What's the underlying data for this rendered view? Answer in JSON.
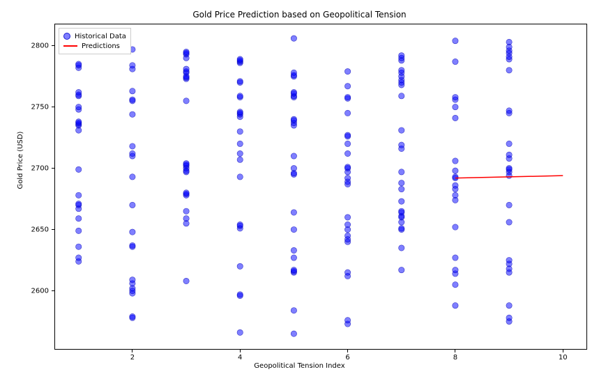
{
  "chart_data": {
    "type": "scatter",
    "title": "Gold Price Prediction based on Geopolitical Tension",
    "xlabel": "Geopolitical Tension Index",
    "ylabel": "Gold Price (USD)",
    "xlim": [
      0.55,
      10.45
    ],
    "ylim": [
      2552,
      2818
    ],
    "xticks": [
      2,
      4,
      6,
      8,
      10
    ],
    "yticks": [
      2600,
      2650,
      2700,
      2750,
      2800
    ],
    "legend": {
      "scatter_label": "Historical Data",
      "line_label": "Predictions"
    },
    "series": [
      {
        "name": "Historical Data",
        "type": "scatter",
        "color": "rgba(0,0,255,0.5)",
        "points": [
          [
            1,
            2624
          ],
          [
            1,
            2627
          ],
          [
            1,
            2636
          ],
          [
            1,
            2649
          ],
          [
            1,
            2659
          ],
          [
            1,
            2667
          ],
          [
            1,
            2670
          ],
          [
            1,
            2671
          ],
          [
            1,
            2678
          ],
          [
            1,
            2699
          ],
          [
            1,
            2731
          ],
          [
            1,
            2735
          ],
          [
            1,
            2736
          ],
          [
            1,
            2737
          ],
          [
            1,
            2738
          ],
          [
            1,
            2748
          ],
          [
            1,
            2750
          ],
          [
            1,
            2759
          ],
          [
            1,
            2760
          ],
          [
            1,
            2762
          ],
          [
            1,
            2782
          ],
          [
            1,
            2784
          ],
          [
            1,
            2785
          ],
          [
            2,
            2578
          ],
          [
            2,
            2579
          ],
          [
            2,
            2598
          ],
          [
            2,
            2600
          ],
          [
            2,
            2602
          ],
          [
            2,
            2606
          ],
          [
            2,
            2609
          ],
          [
            2,
            2636
          ],
          [
            2,
            2637
          ],
          [
            2,
            2648
          ],
          [
            2,
            2670
          ],
          [
            2,
            2693
          ],
          [
            2,
            2710
          ],
          [
            2,
            2712
          ],
          [
            2,
            2718
          ],
          [
            2,
            2744
          ],
          [
            2,
            2755
          ],
          [
            2,
            2756
          ],
          [
            2,
            2763
          ],
          [
            2,
            2781
          ],
          [
            2,
            2784
          ],
          [
            2,
            2797
          ],
          [
            3,
            2608
          ],
          [
            3,
            2655
          ],
          [
            3,
            2659
          ],
          [
            3,
            2665
          ],
          [
            3,
            2678
          ],
          [
            3,
            2679
          ],
          [
            3,
            2680
          ],
          [
            3,
            2697
          ],
          [
            3,
            2698
          ],
          [
            3,
            2700
          ],
          [
            3,
            2702
          ],
          [
            3,
            2703
          ],
          [
            3,
            2704
          ],
          [
            3,
            2755
          ],
          [
            3,
            2773
          ],
          [
            3,
            2774
          ],
          [
            3,
            2775
          ],
          [
            3,
            2778
          ],
          [
            3,
            2779
          ],
          [
            3,
            2781
          ],
          [
            3,
            2790
          ],
          [
            3,
            2793
          ],
          [
            3,
            2794
          ],
          [
            3,
            2795
          ],
          [
            4,
            2566
          ],
          [
            4,
            2596
          ],
          [
            4,
            2597
          ],
          [
            4,
            2620
          ],
          [
            4,
            2651
          ],
          [
            4,
            2653
          ],
          [
            4,
            2654
          ],
          [
            4,
            2693
          ],
          [
            4,
            2707
          ],
          [
            4,
            2712
          ],
          [
            4,
            2720
          ],
          [
            4,
            2730
          ],
          [
            4,
            2742
          ],
          [
            4,
            2744
          ],
          [
            4,
            2745
          ],
          [
            4,
            2746
          ],
          [
            4,
            2758
          ],
          [
            4,
            2759
          ],
          [
            4,
            2770
          ],
          [
            4,
            2771
          ],
          [
            4,
            2786
          ],
          [
            4,
            2787
          ],
          [
            4,
            2788
          ],
          [
            4,
            2789
          ],
          [
            5,
            2565
          ],
          [
            5,
            2584
          ],
          [
            5,
            2615
          ],
          [
            5,
            2616
          ],
          [
            5,
            2617
          ],
          [
            5,
            2627
          ],
          [
            5,
            2633
          ],
          [
            5,
            2650
          ],
          [
            5,
            2664
          ],
          [
            5,
            2695
          ],
          [
            5,
            2696
          ],
          [
            5,
            2700
          ],
          [
            5,
            2710
          ],
          [
            5,
            2735
          ],
          [
            5,
            2737
          ],
          [
            5,
            2739
          ],
          [
            5,
            2740
          ],
          [
            5,
            2758
          ],
          [
            5,
            2759
          ],
          [
            5,
            2761
          ],
          [
            5,
            2762
          ],
          [
            5,
            2775
          ],
          [
            5,
            2776
          ],
          [
            5,
            2778
          ],
          [
            5,
            2806
          ],
          [
            6,
            2573
          ],
          [
            6,
            2576
          ],
          [
            6,
            2612
          ],
          [
            6,
            2615
          ],
          [
            6,
            2640
          ],
          [
            6,
            2642
          ],
          [
            6,
            2645
          ],
          [
            6,
            2650
          ],
          [
            6,
            2654
          ],
          [
            6,
            2660
          ],
          [
            6,
            2687
          ],
          [
            6,
            2689
          ],
          [
            6,
            2692
          ],
          [
            6,
            2697
          ],
          [
            6,
            2700
          ],
          [
            6,
            2701
          ],
          [
            6,
            2712
          ],
          [
            6,
            2720
          ],
          [
            6,
            2726
          ],
          [
            6,
            2727
          ],
          [
            6,
            2745
          ],
          [
            6,
            2757
          ],
          [
            6,
            2758
          ],
          [
            6,
            2767
          ],
          [
            6,
            2779
          ],
          [
            7,
            2617
          ],
          [
            7,
            2635
          ],
          [
            7,
            2650
          ],
          [
            7,
            2651
          ],
          [
            7,
            2656
          ],
          [
            7,
            2660
          ],
          [
            7,
            2661
          ],
          [
            7,
            2664
          ],
          [
            7,
            2665
          ],
          [
            7,
            2673
          ],
          [
            7,
            2683
          ],
          [
            7,
            2688
          ],
          [
            7,
            2697
          ],
          [
            7,
            2716
          ],
          [
            7,
            2719
          ],
          [
            7,
            2731
          ],
          [
            7,
            2759
          ],
          [
            7,
            2768
          ],
          [
            7,
            2770
          ],
          [
            7,
            2772
          ],
          [
            7,
            2775
          ],
          [
            7,
            2778
          ],
          [
            7,
            2780
          ],
          [
            7,
            2788
          ],
          [
            7,
            2790
          ],
          [
            7,
            2792
          ],
          [
            8,
            2588
          ],
          [
            8,
            2605
          ],
          [
            8,
            2614
          ],
          [
            8,
            2617
          ],
          [
            8,
            2627
          ],
          [
            8,
            2652
          ],
          [
            8,
            2674
          ],
          [
            8,
            2678
          ],
          [
            8,
            2683
          ],
          [
            8,
            2686
          ],
          [
            8,
            2692
          ],
          [
            8,
            2693
          ],
          [
            8,
            2698
          ],
          [
            8,
            2706
          ],
          [
            8,
            2741
          ],
          [
            8,
            2750
          ],
          [
            8,
            2756
          ],
          [
            8,
            2758
          ],
          [
            8,
            2787
          ],
          [
            8,
            2804
          ],
          [
            9,
            2575
          ],
          [
            9,
            2578
          ],
          [
            9,
            2588
          ],
          [
            9,
            2615
          ],
          [
            9,
            2618
          ],
          [
            9,
            2622
          ],
          [
            9,
            2625
          ],
          [
            9,
            2656
          ],
          [
            9,
            2670
          ],
          [
            9,
            2694
          ],
          [
            9,
            2697
          ],
          [
            9,
            2699
          ],
          [
            9,
            2700
          ],
          [
            9,
            2708
          ],
          [
            9,
            2711
          ],
          [
            9,
            2720
          ],
          [
            9,
            2745
          ],
          [
            9,
            2747
          ],
          [
            9,
            2780
          ],
          [
            9,
            2789
          ],
          [
            9,
            2791
          ],
          [
            9,
            2794
          ],
          [
            9,
            2796
          ],
          [
            9,
            2799
          ],
          [
            9,
            2803
          ]
        ]
      },
      {
        "name": "Predictions",
        "type": "line",
        "color": "red",
        "x": [
          8,
          10
        ],
        "y": [
          2692,
          2694
        ]
      }
    ]
  }
}
